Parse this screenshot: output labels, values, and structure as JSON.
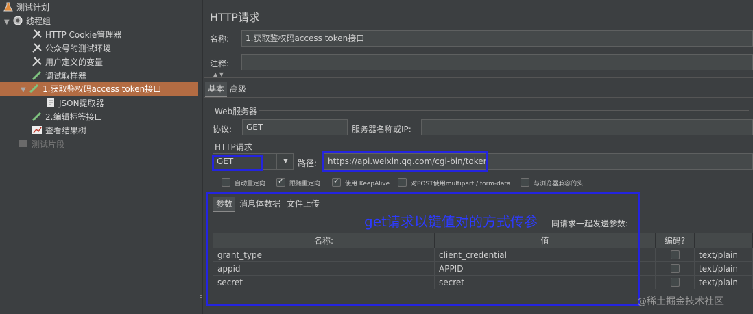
{
  "tree": {
    "items": [
      {
        "label": "测试计划"
      },
      {
        "label": "线程组"
      },
      {
        "label": "HTTP Cookie管理器"
      },
      {
        "label": "公众号的测试环境"
      },
      {
        "label": "用户定义的变量"
      },
      {
        "label": "调试取样器"
      },
      {
        "label": "1.获取鉴权码access token接口"
      },
      {
        "label": "JSON提取器"
      },
      {
        "label": "2.编辑标签接口"
      },
      {
        "label": "查看结果树"
      },
      {
        "label": "测试片段"
      }
    ]
  },
  "panel": {
    "title": "HTTP请求",
    "name_label": "名称:",
    "name_value": "1.获取鉴权码access token接口",
    "comment_label": "注释:",
    "comment_value": "",
    "tabs": [
      "基本",
      "高级"
    ],
    "web_server_group": "Web服务器",
    "protocol_label": "协议:",
    "protocol_value": "GET",
    "server_label": "服务器名称或IP:",
    "server_value": "",
    "http_request_group": "HTTP请求",
    "method_value": "GET",
    "path_label": "路径:",
    "path_value": "https://api.weixin.qq.com/cgi-bin/token",
    "checkboxes": [
      {
        "label": "自动重定向",
        "checked": false
      },
      {
        "label": "跟随重定向",
        "checked": true
      },
      {
        "label": "使用 KeepAlive",
        "checked": true
      },
      {
        "label": "对POST使用multipart / form-data",
        "checked": false
      },
      {
        "label": "与浏览器兼容的头",
        "checked": false
      }
    ],
    "sub_tabs": [
      "参数",
      "消息体数据",
      "文件上传"
    ],
    "send_params_label": "同请求一起发送参数:",
    "table": {
      "headers": [
        "名称:",
        "值",
        "编码?",
        ""
      ],
      "rows": [
        {
          "name": "grant_type",
          "value": "client_credential",
          "encode": false,
          "content_type": "text/plain"
        },
        {
          "name": "appid",
          "value": "APPID",
          "encode": false,
          "content_type": "text/plain"
        },
        {
          "name": "secret",
          "value": "secret",
          "encode": false,
          "content_type": "text/plain"
        }
      ]
    }
  },
  "annotation": "get请求以键值对的方式传参",
  "watermark": "@稀土掘金技术社区",
  "colors": {
    "selection": "#b36c43",
    "annotation_border": "#2424e0",
    "background": "#3c3f41"
  }
}
